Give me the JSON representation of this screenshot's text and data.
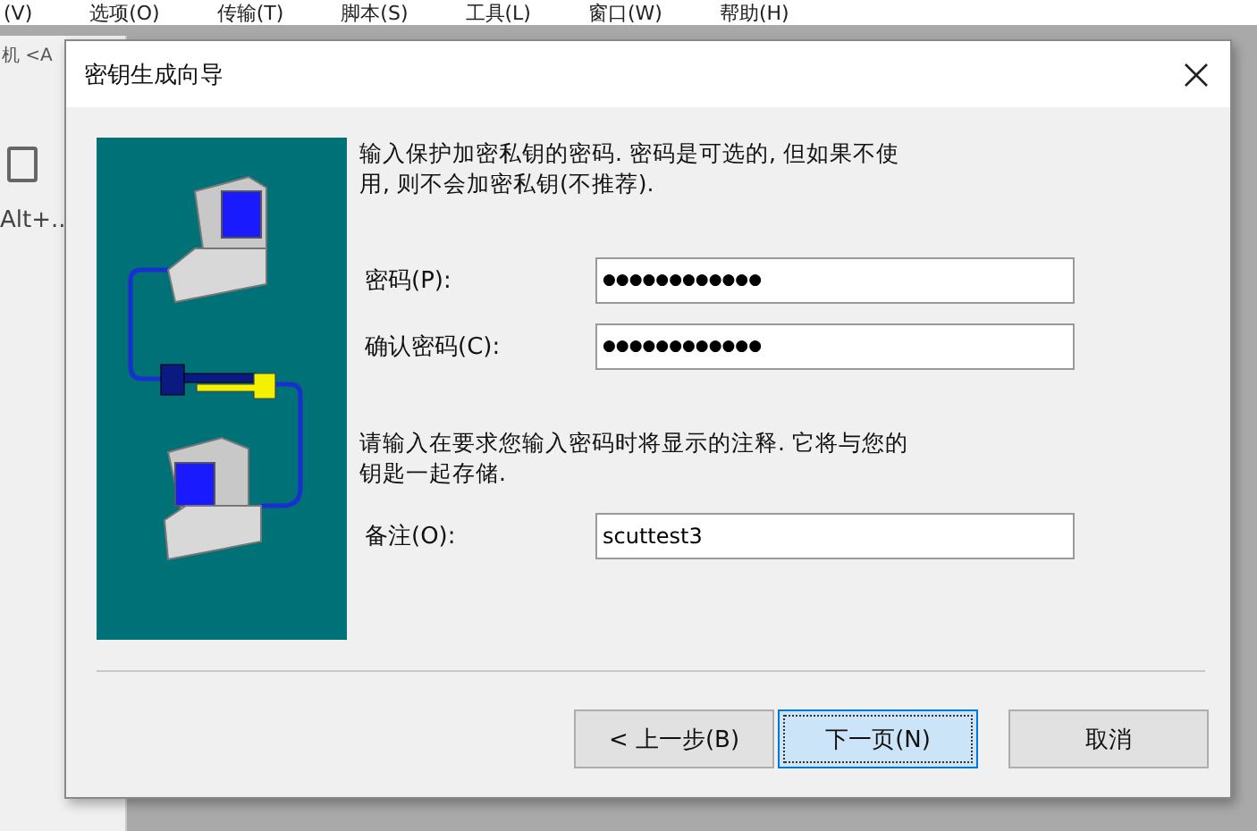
{
  "background_app": {
    "menu": [
      "(V)",
      "选项(O)",
      "传输(T)",
      "脚本(S)",
      "工具(L)",
      "窗口(W)",
      "帮助(H)"
    ],
    "tab_text": "机 <A",
    "shortcut_text": "Alt+.."
  },
  "dialog": {
    "title": "密钥生成向导",
    "intro": "输入保护加密私钥的密码. 密码是可选的, 但如果不使用, 则不会加密私钥(不推荐).",
    "fields": [
      {
        "label": "密码(P):",
        "value": "●●●●●●●●●●●●"
      },
      {
        "label": "确认密码(C):",
        "value": "●●●●●●●●●●●●"
      }
    ],
    "note_intro": "请输入在要求您输入密码时将显示的注释. 它将与您的钥匙一起存储.",
    "note_field": {
      "label": "备注(O):",
      "value": "scuttest3"
    },
    "buttons": [
      {
        "label": "< 上一步(B)",
        "default": false
      },
      {
        "label": "下一页(N)",
        "default": true
      },
      {
        "label": "取消",
        "default": false
      }
    ]
  }
}
